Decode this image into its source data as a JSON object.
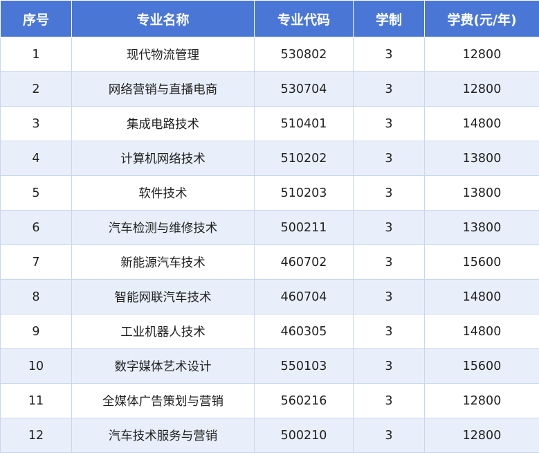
{
  "table": {
    "headers": [
      "序号",
      "专业名称",
      "专业代码",
      "学制",
      "学费(元/年)"
    ],
    "rows": [
      [
        "1",
        "现代物流管理",
        "530802",
        "3",
        "12800"
      ],
      [
        "2",
        "网络营销与直播电商",
        "530704",
        "3",
        "12800"
      ],
      [
        "3",
        "集成电路技术",
        "510401",
        "3",
        "14800"
      ],
      [
        "4",
        "计算机网络技术",
        "510202",
        "3",
        "13800"
      ],
      [
        "5",
        "软件技术",
        "510203",
        "3",
        "13800"
      ],
      [
        "6",
        "汽车检测与维修技术",
        "500211",
        "3",
        "13800"
      ],
      [
        "7",
        "新能源汽车技术",
        "460702",
        "3",
        "15600"
      ],
      [
        "8",
        "智能网联汽车技术",
        "460704",
        "3",
        "14800"
      ],
      [
        "9",
        "工业机器人技术",
        "460305",
        "3",
        "14800"
      ],
      [
        "10",
        "数字媒体艺术设计",
        "550103",
        "3",
        "15600"
      ],
      [
        "11",
        "全媒体广告策划与营销",
        "560216",
        "3",
        "12800"
      ],
      [
        "12",
        "汽车技术服务与营销",
        "500210",
        "3",
        "12800"
      ]
    ]
  },
  "colors": {
    "header_background": "#4a77d6",
    "header_text": "#ffffff",
    "row_alt_background": "#e9effa",
    "grid_line": "#c9d6ef"
  }
}
